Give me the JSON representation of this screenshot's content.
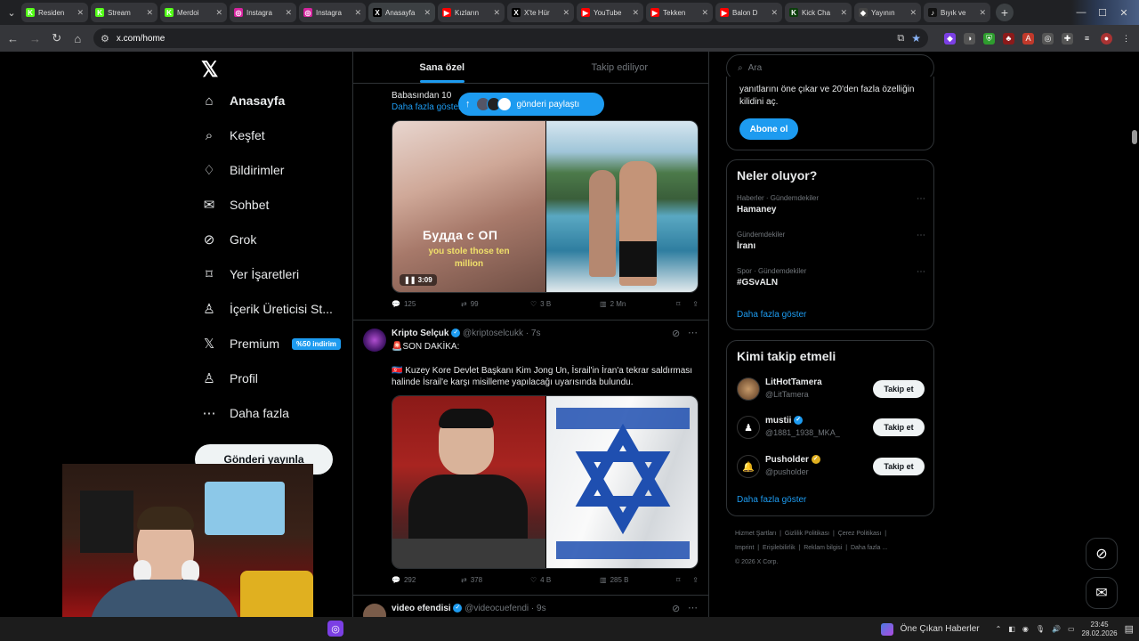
{
  "browser": {
    "tabs": [
      {
        "label": "Residen",
        "fav": "K",
        "color": "#53fc18"
      },
      {
        "label": "Stream",
        "fav": "K",
        "color": "#53fc18"
      },
      {
        "label": "Merdoi",
        "fav": "K",
        "color": "#53fc18"
      },
      {
        "label": "Instagra",
        "fav": "◎",
        "color": "#d6249f"
      },
      {
        "label": "Instagra",
        "fav": "◎",
        "color": "#d6249f"
      },
      {
        "label": "Anasayfa",
        "fav": "X",
        "color": "#000000",
        "active": true
      },
      {
        "label": "Kızların",
        "fav": "▶",
        "color": "#ff0000"
      },
      {
        "label": "X'te Hür",
        "fav": "X",
        "color": "#000000"
      },
      {
        "label": "YouTube",
        "fav": "▶",
        "color": "#ff0000"
      },
      {
        "label": "Tekken",
        "fav": "▶",
        "color": "#ff0000"
      },
      {
        "label": "Balon D",
        "fav": "▶",
        "color": "#ff0000"
      },
      {
        "label": "Kick Cha",
        "fav": "K",
        "color": "#0b3d0b"
      },
      {
        "label": "Yayının",
        "fav": "◆",
        "color": "#444444"
      },
      {
        "label": "Bıyık ve",
        "fav": "♪",
        "color": "#111111"
      }
    ],
    "url": "x.com/home"
  },
  "nav": {
    "items": [
      {
        "label": "Anasayfa",
        "icon": "home-icon",
        "glyph": "⌂"
      },
      {
        "label": "Keşfet",
        "icon": "search-icon",
        "glyph": "⌕"
      },
      {
        "label": "Bildirimler",
        "icon": "bell-icon",
        "glyph": "♢"
      },
      {
        "label": "Sohbet",
        "icon": "mail-icon",
        "glyph": "✉"
      },
      {
        "label": "Grok",
        "icon": "grok-icon",
        "glyph": "⊘"
      },
      {
        "label": "Yer İşaretleri",
        "icon": "bookmark-icon",
        "glyph": "⌑"
      },
      {
        "label": "İçerik Üreticisi St...",
        "icon": "creator-icon",
        "glyph": "♙"
      },
      {
        "label": "Premium",
        "icon": "x-premium-icon",
        "glyph": "𝕏"
      },
      {
        "label": "Profil",
        "icon": "profile-icon",
        "glyph": "♙"
      },
      {
        "label": "Daha fazla",
        "icon": "more-icon",
        "glyph": "⋯"
      }
    ],
    "premium_badge": "%50 indirim",
    "post_button": "Gönderi yayınla"
  },
  "feed": {
    "tab_foryou": "Sana özel",
    "tab_following": "Takip ediliyor",
    "show_new_posts": "gönderi paylaştı",
    "post1": {
      "text": "Babasından 10",
      "show_more": "Daha fazla göster",
      "video_caption_ru": "Будда с ОП",
      "video_caption_en": "you stole those ten million",
      "video_time": "3:09",
      "replies": "125",
      "reposts": "99",
      "likes": "3 B",
      "views": "2 Mn"
    },
    "post2": {
      "name": "Kripto Selçuk",
      "handle": "@kriptoselcukk",
      "time": "7s",
      "line1": "🚨SON DAKİKA:",
      "line2": "🇰🇵 Kuzey Kore Devlet Başkanı Kim Jong Un, İsrail'in İran'a tekrar saldırması halinde İsrail'e karşı misilleme yapılacağı uyarısında bulundu.",
      "replies": "292",
      "reposts": "378",
      "likes": "4 B",
      "views": "285 B"
    },
    "post3": {
      "name": "video efendisi",
      "handle": "@videocuefendi",
      "time": "9s"
    }
  },
  "sidebar": {
    "search_placeholder": "Ara",
    "premium_text": "yanıtlarını öne çıkar ve 20'den fazla özelliğin kilidini aç.",
    "subscribe": "Abone ol",
    "trends_title": "Neler oluyor?",
    "trends": [
      {
        "meta": "Haberler · Gündemdekiler",
        "name": "Hamaney"
      },
      {
        "meta": "Gündemdekiler",
        "name": "İranı"
      },
      {
        "meta": "Spor · Gündemdekiler",
        "name": "#GSvALN"
      }
    ],
    "trends_more": "Daha fazla göster",
    "who_title": "Kimi takip etmeli",
    "who": [
      {
        "name": "LitHotTamera",
        "handle": "@LitTamera",
        "verified": false
      },
      {
        "name": "mustii",
        "handle": "@1881_1938_MKA_",
        "verified": true
      },
      {
        "name": "Pusholder",
        "handle": "@pusholder",
        "verified": true
      }
    ],
    "follow_label": "Takip et",
    "who_more": "Daha fazla göster",
    "footer": [
      "Hizmet Şartları",
      "Gizlilik Politikası",
      "Çerez Politikası",
      "Imprint",
      "Erişilebilirlik",
      "Reklam bilgisi",
      "Daha fazla ...",
      "© 2026 X Corp."
    ]
  },
  "taskbar": {
    "news": "Öne Çıkan Haberler",
    "time": "23:45",
    "date": "28.02.2026"
  },
  "colors": {
    "accent": "#1d9bf0",
    "bg": "#000000",
    "border": "#2f3336",
    "muted": "#71767b"
  }
}
